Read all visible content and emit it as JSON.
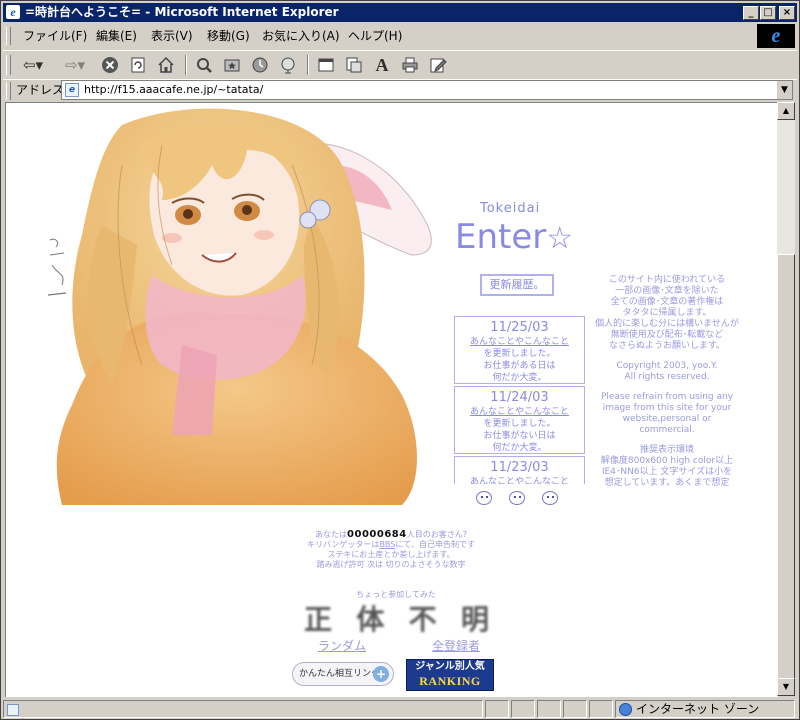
{
  "window": {
    "title": "=時計台へようこそ= - Microsoft Internet Explorer",
    "minimize": "_",
    "maximize": "□",
    "close": "×"
  },
  "menu": {
    "items": [
      "ファイル(F)",
      "編集(E)",
      "表示(V)",
      "移動(G)",
      "お気に入り(A)",
      "ヘルプ(H)"
    ]
  },
  "toolbar": {
    "icons": [
      "back-icon",
      "forward-icon",
      "stop-icon",
      "refresh-icon",
      "home-icon",
      "search-icon",
      "favorites-icon",
      "history-icon",
      "channels-icon",
      "fullscreen-icon",
      "mail-icon",
      "font-icon",
      "print-icon",
      "edit-icon"
    ]
  },
  "address": {
    "label": "アドレス",
    "url": "http://f15.aaacafe.ne.jp/~tatata/"
  },
  "page": {
    "site_name": "Tokeidai",
    "enter": "Enter",
    "enter_star": "☆",
    "history_button": "更新履歴。",
    "updates": [
      {
        "date": "11/25/03",
        "link": "あんなことやこんなこと",
        "l2": "を更新しました。",
        "l3": "お仕事がある日は",
        "l4": "何だか大変。"
      },
      {
        "date": "11/24/03",
        "link": "あんなことやこんなこと",
        "l2": "を更新しました。",
        "l3": "お仕事がない日は",
        "l4": "何だか大変。"
      },
      {
        "date": "11/23/03",
        "link": "あんなことやこんなこと",
        "l2": "",
        "l3": "",
        "l4": ""
      }
    ],
    "notice": {
      "jp1": "このサイト内に使われている",
      "jp2": "一部の画像･文章を除いた",
      "jp3": "全ての画像･文章の著作権は",
      "jp4": "タタタに帰属します。",
      "jp5": "個人的に楽しむ分には構いませんが",
      "jp6": "無断使用及び配布･転載など",
      "jp7": "なさらぬようお願いします。",
      "copy1": "Copyright 2003, yoo.Y.",
      "copy2": "All rights reserved.",
      "en1": "Please refrain from using any",
      "en2": "image from this site for your",
      "en3": "website,personal or",
      "en4": "commercial.",
      "env_title": "推奨表示環境",
      "env1": "解像度800x600 high color以上",
      "env2": "IE4･NN6以上 文字サイズは小を",
      "env3": "想定しています。あくまで想定"
    },
    "counter": {
      "pre": "あなたは",
      "number": "00000684",
      "post": "人目のお客さん?",
      "l2a": "キリバンゲッターは",
      "l2link": "BBS",
      "l2b": "にて、自己申告制です",
      "l3": "ステキにお土産とか差し上げます。",
      "l4": "踏み逃げ許可 次は 切りのよさそうな数字"
    },
    "joined_caption": "ちょっと参加してみた",
    "shotai": [
      "正",
      "体",
      "不",
      "明"
    ],
    "links": [
      "ランダム",
      "全登録者"
    ],
    "badge_link": "かんたん相互リンク",
    "badge_link_icon": "+",
    "ranking_top": "ジャンル別人気",
    "ranking_bottom": "RANKING"
  },
  "status": {
    "zone": "インターネット ゾーン"
  }
}
